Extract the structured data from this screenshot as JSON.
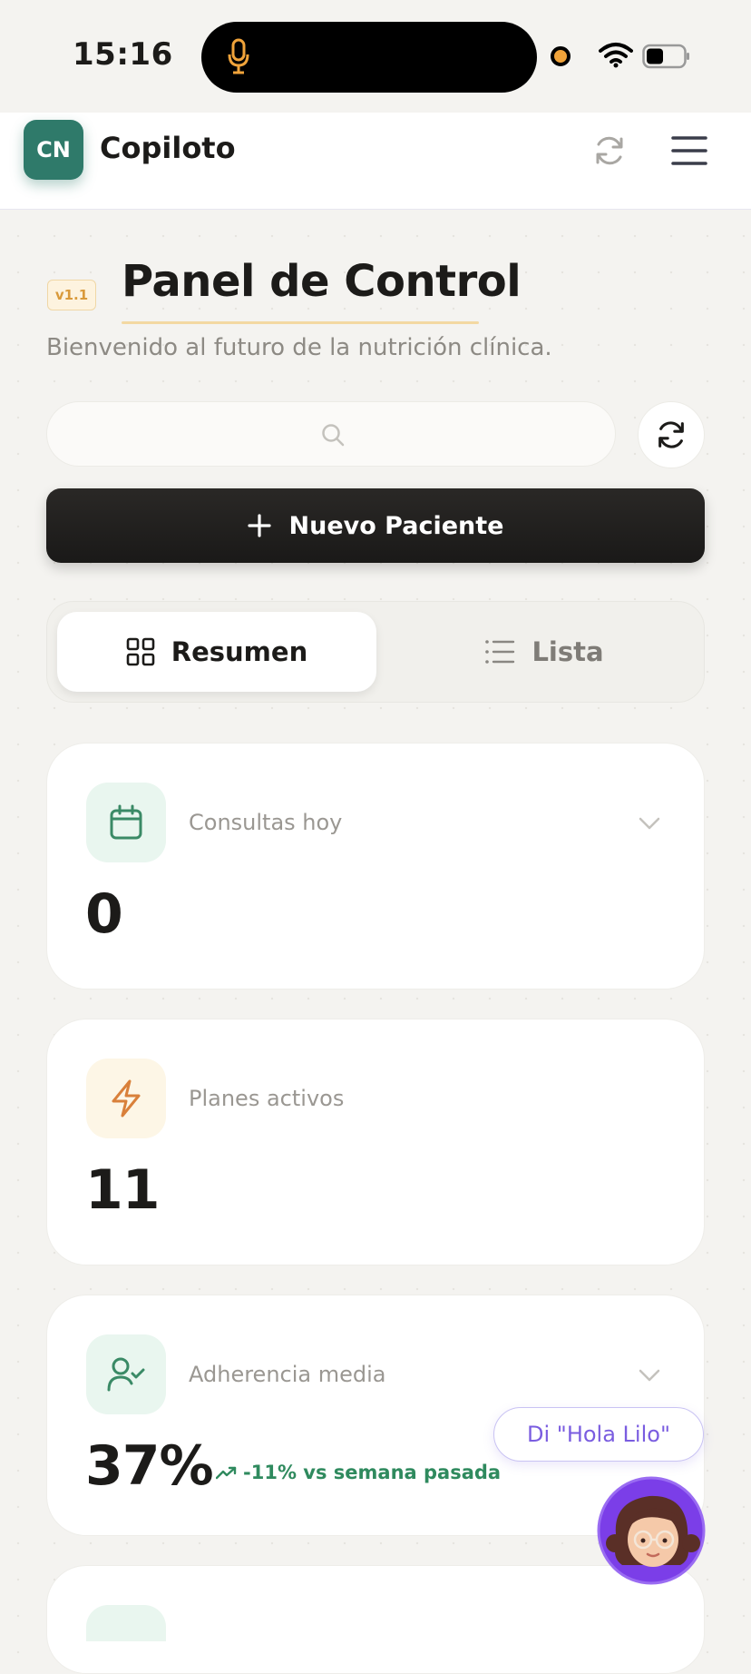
{
  "status_bar": {
    "time": "15:16"
  },
  "header": {
    "logo_initials": "CN",
    "app_name": "Copiloto"
  },
  "page": {
    "version_badge": "v1.1",
    "title": "Panel de Control",
    "subtitle": "Bienvenido al futuro de la nutrición clínica."
  },
  "search": {
    "value": "",
    "placeholder": ""
  },
  "actions": {
    "new_patient_label": "Nuevo Paciente"
  },
  "tabs": [
    {
      "label": "Resumen",
      "icon": "grid-icon",
      "active": true
    },
    {
      "label": "Lista",
      "icon": "list-icon",
      "active": false
    }
  ],
  "cards": [
    {
      "label": "Consultas hoy",
      "value": "0",
      "icon": "calendar-icon",
      "icon_bg": "#e9f6ef",
      "icon_color": "#3a8a66",
      "expandable": true
    },
    {
      "label": "Planes activos",
      "value": "11",
      "icon": "lightning-icon",
      "icon_bg": "#fdf6e6",
      "icon_color": "#d9803a",
      "expandable": false
    },
    {
      "label": "Adherencia media",
      "value": "37%",
      "trend": "-11% vs semana pasada",
      "icon": "user-check-icon",
      "icon_bg": "#e9f6ef",
      "icon_color": "#3a8a66",
      "expandable": true
    }
  ],
  "assistant": {
    "prompt": "Di \"Hola Lilo\""
  },
  "colors": {
    "brand": "#2f7a6a",
    "accent": "#7a5de0",
    "trend": "#2f8a5e"
  }
}
